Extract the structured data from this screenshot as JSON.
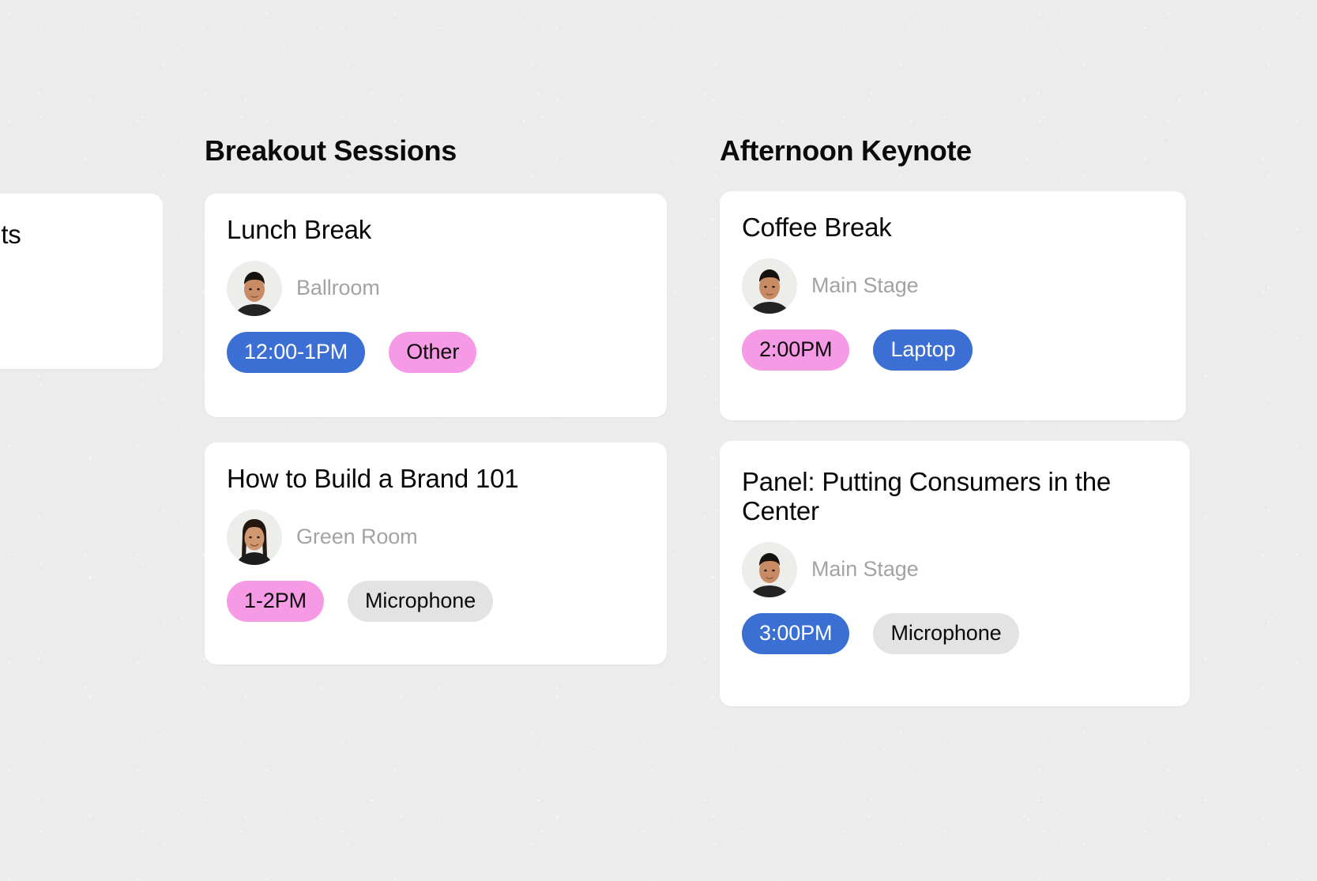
{
  "board": {
    "columns": [
      {
        "id": "breakout",
        "title": "Breakout Sessions"
      },
      {
        "id": "keynote",
        "title": "Afternoon Keynote"
      }
    ]
  },
  "partial_card": {
    "title": "& Greets",
    "note": "card clipped by left edge of viewport"
  },
  "cards": {
    "lunch": {
      "title": "Lunch Break",
      "location": "Ballroom",
      "avatar": "male-avatar",
      "tags": [
        {
          "label": "12:00-1PM",
          "style": "blue"
        },
        {
          "label": "Other",
          "style": "pink"
        }
      ]
    },
    "brand": {
      "title": "How to Build a Brand 101",
      "location": "Green Room",
      "avatar": "female-avatar",
      "tags": [
        {
          "label": "1-2PM",
          "style": "pink"
        },
        {
          "label": "Microphone",
          "style": "gray"
        }
      ]
    },
    "coffee": {
      "title": "Coffee Break",
      "location": "Main Stage",
      "avatar": "male-avatar",
      "tags": [
        {
          "label": "2:00PM",
          "style": "pink"
        },
        {
          "label": "Laptop",
          "style": "blue"
        }
      ]
    },
    "panel": {
      "title": "Panel: Putting Consumers in the Center",
      "location": "Main Stage",
      "avatar": "male-avatar",
      "tags": [
        {
          "label": "3:00PM",
          "style": "blue"
        },
        {
          "label": "Microphone",
          "style": "gray"
        }
      ]
    }
  },
  "colors": {
    "background": "#ececec",
    "card": "#ffffff",
    "tag_blue": "#3b6fd4",
    "tag_pink": "#f79ae6",
    "tag_gray": "#e3e3e3",
    "title_text": "#070707",
    "location_text": "#a3a3a3"
  }
}
